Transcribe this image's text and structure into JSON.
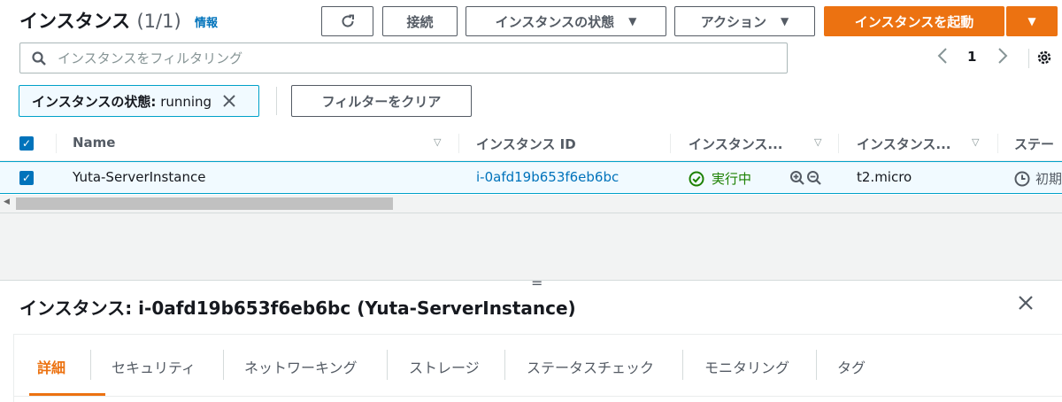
{
  "header": {
    "title": "インスタンス",
    "count": "(1/1)",
    "info_link": "情報",
    "connect_label": "接続",
    "state_menu_label": "インスタンスの状態",
    "actions_label": "アクション",
    "launch_label": "インスタンスを起動"
  },
  "search": {
    "placeholder": "インスタンスをフィルタリング"
  },
  "pagination": {
    "page": "1"
  },
  "filter_chip": {
    "key": "インスタンスの状態:",
    "value": "running"
  },
  "clear_filters_label": "フィルターをクリア",
  "table": {
    "columns": [
      "Name",
      "インスタンス ID",
      "インスタンス...",
      "インスタンス...",
      "ステー"
    ],
    "row": {
      "name": "Yuta-ServerInstance",
      "instance_id": "i-0afd19b653f6eb6bc",
      "state": "実行中",
      "type": "t2.micro",
      "status": "初期"
    }
  },
  "detail": {
    "title": "インスタンス: i-0afd19b653f6eb6bc (Yuta-ServerInstance)",
    "tabs": [
      "詳細",
      "セキュリティ",
      "ネットワーキング",
      "ストレージ",
      "ステータスチェック",
      "モニタリング",
      "タグ"
    ]
  },
  "colors": {
    "primary": "#ec7211",
    "link": "#0073bb",
    "running": "#1d8102",
    "selected_border": "#00a1c9"
  }
}
